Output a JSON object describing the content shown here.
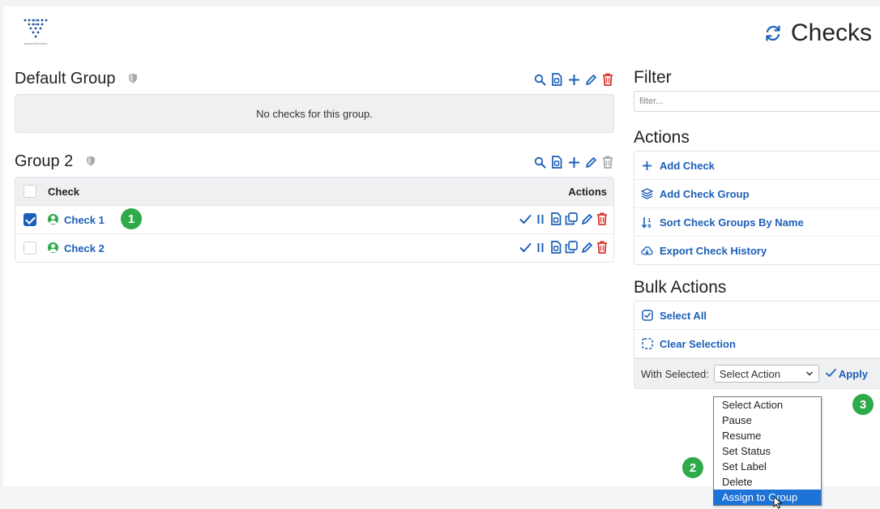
{
  "header": {
    "title": "Checks",
    "logo_caption": "SMARTFORTRESS",
    "refresh_icon": "refresh-icon"
  },
  "groups": [
    {
      "name": "Default Group",
      "empty_text": "No checks for this group.",
      "tools": [
        "search-icon",
        "pdf-icon",
        "plus-icon",
        "pencil-icon",
        "trash-icon"
      ]
    },
    {
      "name": "Group 2",
      "columns": {
        "check": "Check",
        "actions": "Actions"
      },
      "rows": [
        {
          "name": "Check 1",
          "checked": true,
          "status": "up",
          "badge": "1"
        },
        {
          "name": "Check 2",
          "checked": false,
          "status": "up"
        }
      ],
      "row_action_icons": [
        "check-icon",
        "pause-icon",
        "pdf-icon",
        "copy-icon",
        "pencil-icon",
        "trash-icon"
      ]
    }
  ],
  "filter": {
    "title": "Filter",
    "placeholder": "filter..."
  },
  "actions": {
    "title": "Actions",
    "items": [
      {
        "label": "Add Check",
        "icon": "plus-icon"
      },
      {
        "label": "Add Check Group",
        "icon": "layers-icon"
      },
      {
        "label": "Sort Check Groups By Name",
        "icon": "sort-icon"
      },
      {
        "label": "Export Check History",
        "icon": "cloud-download-icon"
      }
    ]
  },
  "bulk_actions": {
    "title": "Bulk Actions",
    "select_all": "Select All",
    "clear_selection": "Clear Selection",
    "with_selected_label": "With Selected:",
    "select_value": "Select Action",
    "apply_label": "Apply",
    "options": [
      "Select Action",
      "Pause",
      "Resume",
      "Set Status",
      "Set Label",
      "Delete",
      "Assign to Group"
    ],
    "highlighted_option": "Assign to Group",
    "badges": {
      "dropdown": "2",
      "apply": "3"
    }
  },
  "colors": {
    "link_blue": "#1c5fb8",
    "status_green": "#2eaa4a",
    "danger_red": "#d9342b",
    "highlight_blue": "#1e73d8"
  }
}
